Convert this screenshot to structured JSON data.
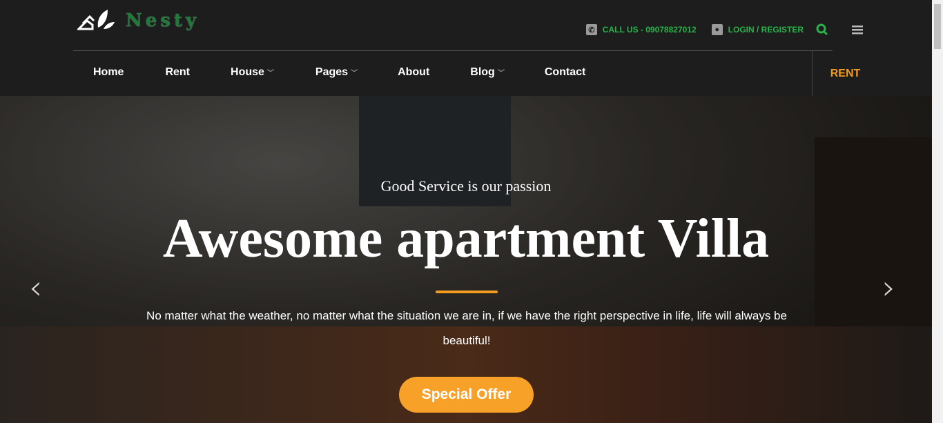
{
  "brand": {
    "name": "Nesty"
  },
  "topbar": {
    "call": "CALL US - 09078827012",
    "login": "LOGIN / REGISTER"
  },
  "nav": {
    "items": [
      {
        "label": "Home"
      },
      {
        "label": "Rent"
      },
      {
        "label": "House"
      },
      {
        "label": "Pages"
      },
      {
        "label": "About"
      },
      {
        "label": "Blog"
      },
      {
        "label": "Contact"
      }
    ],
    "cta": "RENT"
  },
  "hero": {
    "subtitle": "Good Service is our passion",
    "title": "Awesome apartment Villa",
    "description": "No matter what the weather, no matter what the situation we are in, if we have the right perspective in life, life will always be beautiful!",
    "button": "Special Offer"
  },
  "colors": {
    "accent": "#f39c1f",
    "green": "#27b34a"
  }
}
